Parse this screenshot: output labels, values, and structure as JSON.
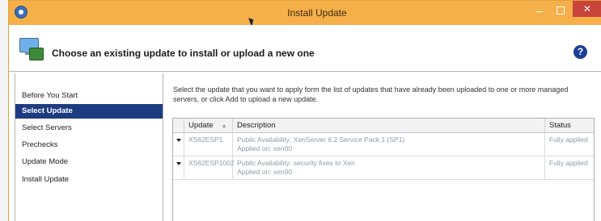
{
  "window": {
    "title": "Install Update",
    "minimize_symbol": "–",
    "close_symbol": "✕"
  },
  "header": {
    "title": "Choose an existing update to install or upload a new one",
    "help_symbol": "?"
  },
  "sidebar": {
    "items": [
      {
        "label": "Before You Start",
        "selected": false
      },
      {
        "label": "Select Update",
        "selected": true
      },
      {
        "label": "Select Servers",
        "selected": false
      },
      {
        "label": "Prechecks",
        "selected": false
      },
      {
        "label": "Update Mode",
        "selected": false
      },
      {
        "label": "Install Update",
        "selected": false
      }
    ]
  },
  "main": {
    "instructions": "Select the update that you want to apply form the list of updates that have already been uploaded to one or more managed servers, or click Add to upload a new update.",
    "table": {
      "columns": [
        "Update",
        "Description",
        "Status"
      ],
      "rows": [
        {
          "update": "XS62ESP1",
          "description_line1": "Public Availability: XenServer 6.2 Service Pack 1 (SP1)",
          "description_line2": "Applied on: xen00",
          "status": "Fully applied"
        },
        {
          "update": "XS62ESP1002",
          "description_line1": "Public Availability: security fixes to Xen",
          "description_line2": "Applied on: xen00",
          "status": "Fully applied"
        }
      ]
    }
  },
  "colors": {
    "titlebar": "#f5b04a",
    "selection": "#1c3b80",
    "close_button": "#c9443b",
    "help_icon": "#1a3f95"
  }
}
